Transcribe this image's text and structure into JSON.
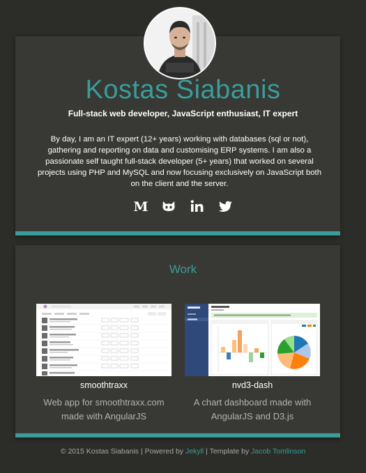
{
  "profile": {
    "name": "Kostas Siabanis",
    "tagline": "Full-stack web developer, JavaScript enthusiast, IT expert",
    "bio": "By day, I am an IT expert (12+ years) working with databases (sql or not), gathering and reporting on data and customising ERP systems. I am also a passionate self taught full-stack developer (5+ years) that worked on several projects using PHP and MySQL and now focusing exclusively on JavaScript both on the client and the server."
  },
  "socials": [
    {
      "icon": "medium-icon"
    },
    {
      "icon": "github-icon"
    },
    {
      "icon": "linkedin-icon"
    },
    {
      "icon": "twitter-icon"
    }
  ],
  "work": {
    "title": "Work",
    "projects": [
      {
        "name": "smoothtraxx",
        "description": "Web app for smoothtraxx.com made with AngularJS"
      },
      {
        "name": "nvd3-dash",
        "description": "A chart dashboard made with AngularJS and D3.js"
      }
    ]
  },
  "footer": {
    "prefix": "© 2015 Kostas Siabanis | Powered by ",
    "jekyll": "Jekyll",
    "middle": " | Template by ",
    "author": "Jacob Tomlinson"
  },
  "colors": {
    "accent": "#3a9d9a",
    "background": "#2c2d29",
    "card": "#383834"
  }
}
